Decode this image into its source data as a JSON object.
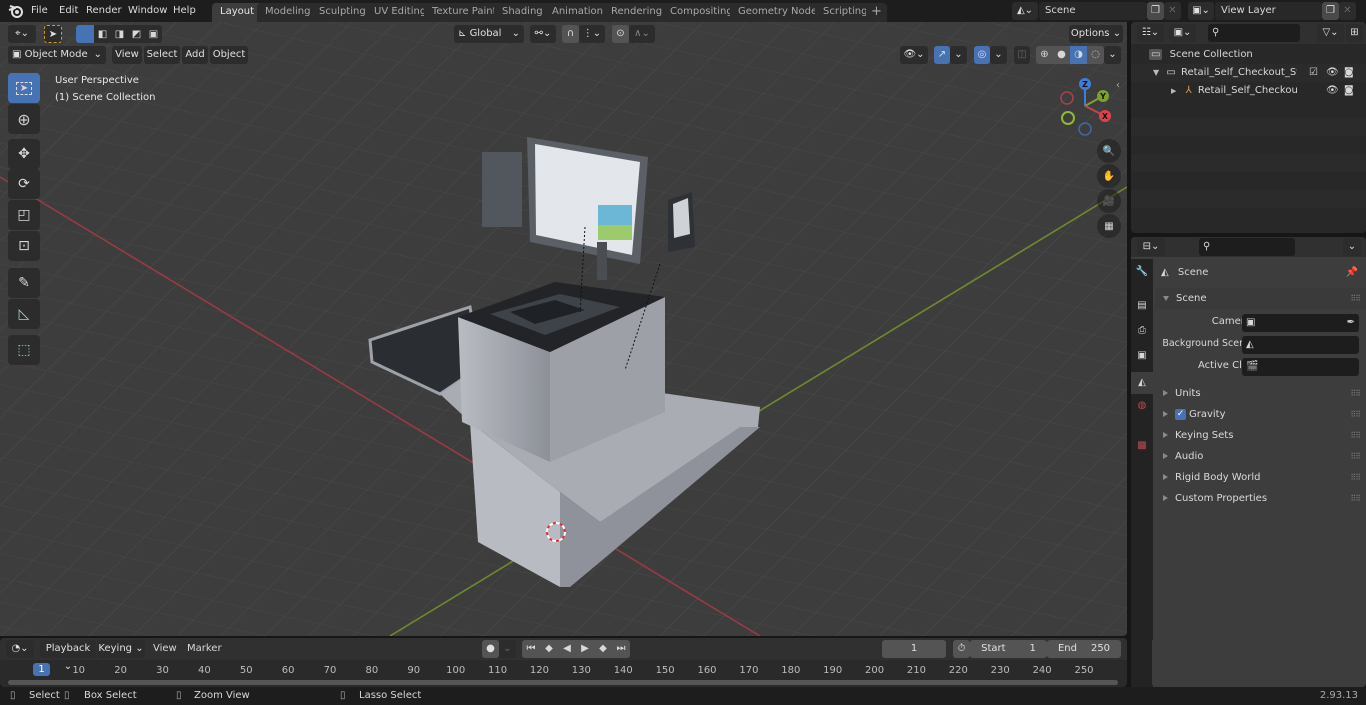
{
  "topbar": {
    "menu": [
      "File",
      "Edit",
      "Render",
      "Window",
      "Help"
    ],
    "workspaces": [
      {
        "label": "Layout",
        "active": true
      },
      {
        "label": "Modeling"
      },
      {
        "label": "Sculpting"
      },
      {
        "label": "UV Editing"
      },
      {
        "label": "Texture Paint"
      },
      {
        "label": "Shading"
      },
      {
        "label": "Animation"
      },
      {
        "label": "Rendering"
      },
      {
        "label": "Compositing"
      },
      {
        "label": "Geometry Nodes"
      },
      {
        "label": "Scripting"
      }
    ],
    "add_tab_label": "+",
    "scene_name": "Scene",
    "view_layer_name": "View Layer"
  },
  "viewport": {
    "mode": "Object Mode",
    "menus": [
      "View",
      "Select",
      "Add",
      "Object"
    ],
    "transform_orientation": "Global",
    "options_label": "Options",
    "overlay_text_1": "User Perspective",
    "overlay_text_2": "(1) Scene Collection",
    "gizmo_axes": {
      "x": "X",
      "y": "Y",
      "z": "Z"
    },
    "colors": {
      "x_axis": "#c5434f",
      "y_axis": "#7da12e",
      "z_axis": "#3e7fd6",
      "accent": "#4772b3"
    }
  },
  "outliner": {
    "root": "Scene Collection",
    "items": [
      {
        "label": "Retail_Self_Checkout_System",
        "type": "collection",
        "expanded": true,
        "checked": true
      },
      {
        "label": "Retail_Self_Checkout_Sy",
        "type": "object",
        "expanded": false
      }
    ]
  },
  "properties": {
    "breadcrumb": "Scene",
    "panel_title": "Scene",
    "fields": [
      {
        "label": "Camera",
        "value": ""
      },
      {
        "label": "Background Scene",
        "value": ""
      },
      {
        "label": "Active Clip",
        "value": ""
      }
    ],
    "collapsed_panels": [
      {
        "label": "Units"
      },
      {
        "label": "Gravity",
        "checkbox": true
      },
      {
        "label": "Keying Sets"
      },
      {
        "label": "Audio"
      },
      {
        "label": "Rigid Body World"
      },
      {
        "label": "Custom Properties"
      }
    ]
  },
  "timeline": {
    "menus": [
      "Playback",
      "Keying",
      "View",
      "Marker"
    ],
    "current_frame": "1",
    "start_label": "Start",
    "start": "1",
    "end_label": "End",
    "end": "250",
    "ticks": [
      "10",
      "20",
      "30",
      "40",
      "50",
      "60",
      "70",
      "80",
      "90",
      "100",
      "110",
      "120",
      "130",
      "140",
      "150",
      "160",
      "170",
      "180",
      "190",
      "200",
      "210",
      "220",
      "230",
      "240",
      "250"
    ],
    "playhead": "1"
  },
  "statusbar": {
    "hints": [
      "Select",
      "Box Select",
      "Zoom View",
      "Lasso Select"
    ],
    "version": "2.93.13"
  }
}
